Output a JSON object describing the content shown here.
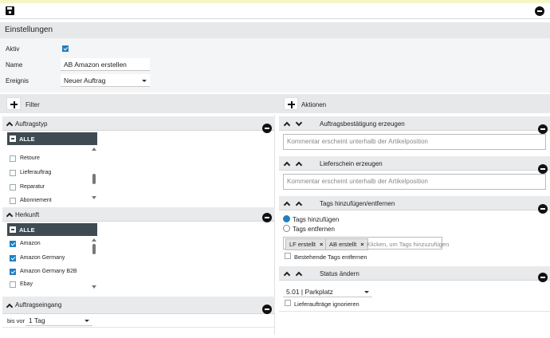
{
  "header": {
    "title": "Einstellungen"
  },
  "settings": {
    "aktiv_label": "Aktiv",
    "aktiv_checked": true,
    "name_label": "Name",
    "name_value": "AB Amazon erstellen",
    "ereignis_label": "Ereignis",
    "ereignis_value": "Neuer Auftrag"
  },
  "filter": {
    "label": "Filter",
    "auftragstyp": {
      "title": "Auftragstyp",
      "all_label": "ALLE",
      "items": [
        {
          "label": "Retoure",
          "checked": false
        },
        {
          "label": "Lieferauftrag",
          "checked": false
        },
        {
          "label": "Reparatur",
          "checked": false
        },
        {
          "label": "Abonnement",
          "checked": false
        }
      ]
    },
    "herkunft": {
      "title": "Herkunft",
      "all_label": "ALLE",
      "items": [
        {
          "label": "Amazon",
          "checked": true
        },
        {
          "label": "Amazon Germany",
          "checked": true
        },
        {
          "label": "Amazon Germany B2B",
          "checked": true
        },
        {
          "label": "Ebay",
          "checked": false
        }
      ]
    },
    "auftragseingang": {
      "title": "Auftragseingang",
      "bis_vor_label": "bis vor",
      "period_value": "1 Tag"
    }
  },
  "actions": {
    "label": "Aktionen",
    "items": [
      {
        "title": "Auftragsbestätigung erzeugen",
        "placeholder": "Kommentar erscheint unterhalb der Artikelposition"
      },
      {
        "title": "Lieferschein erzeugen",
        "placeholder": "Kommentar erscheint unterhalb der Artikelposition"
      }
    ],
    "tags": {
      "title": "Tags hinzufügen/entfernen",
      "radio_add": "Tags hinzufügen",
      "radio_remove": "Tags entfernen",
      "selected": "add",
      "chips": [
        "LF erstellt",
        "AB erstellt"
      ],
      "input_placeholder": "Klicken, um Tags hinzuzufügen",
      "remove_existing_label": "Bestehende Tags entfernen"
    },
    "status": {
      "title": "Status ändern",
      "value": "5.01 | Parkplatz",
      "ignore_label": "Lieferaufträge ignorieren"
    }
  },
  "colors": {
    "accent": "#1f7fc4",
    "dark_header": "#3e4b52",
    "section_bg": "#e6e8ea"
  }
}
